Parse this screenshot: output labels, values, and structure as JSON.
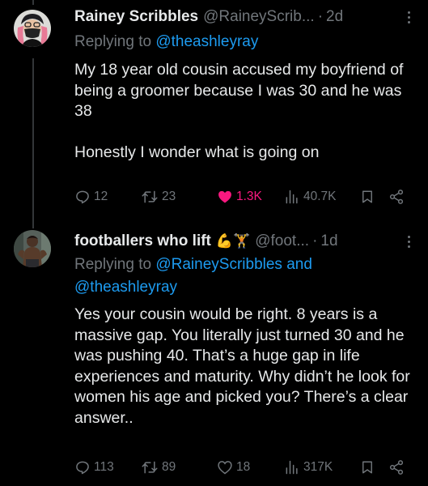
{
  "tweets": [
    {
      "name": "Rainey Scribbles",
      "handle": "@RaineyScrib...",
      "separator": "·",
      "time": "2d",
      "replying_prefix": "Replying to ",
      "replying_mentions": "@theashleyray",
      "text": "My 18 year old cousin accused my boyfriend of being a groomer because I was 30 and he was 38\n\nHonestly I wonder what is going on",
      "stats": {
        "replies": "12",
        "retweets": "23",
        "likes": "1.3K",
        "views": "40.7K"
      },
      "liked": true
    },
    {
      "name": "footballers who lift",
      "name_emoji": "💪🏋",
      "handle": "@foot...",
      "separator": "·",
      "time": "1d",
      "replying_prefix": "Replying to ",
      "replying_mentions_1": "@RaineyScribbles and",
      "replying_mentions_2": "@theashleyray",
      "text": "Yes your cousin would be right. 8 years is a massive gap. You literally just turned 30 and he was pushing 40. That’s a huge gap in life experiences and maturity. Why didn’t he look for women his age and picked you? There’s a clear answer..",
      "stats": {
        "replies": "113",
        "retweets": "89",
        "likes": "18",
        "views": "317K"
      },
      "liked": false
    }
  ],
  "colors": {
    "background": "#000000",
    "text": "#e7e9ea",
    "muted": "#71767b",
    "link": "#1d9bf0",
    "like": "#f91880"
  },
  "icons": [
    "reply-icon",
    "retweet-icon",
    "like-icon",
    "views-icon",
    "bookmark-icon",
    "share-icon",
    "more-icon"
  ]
}
